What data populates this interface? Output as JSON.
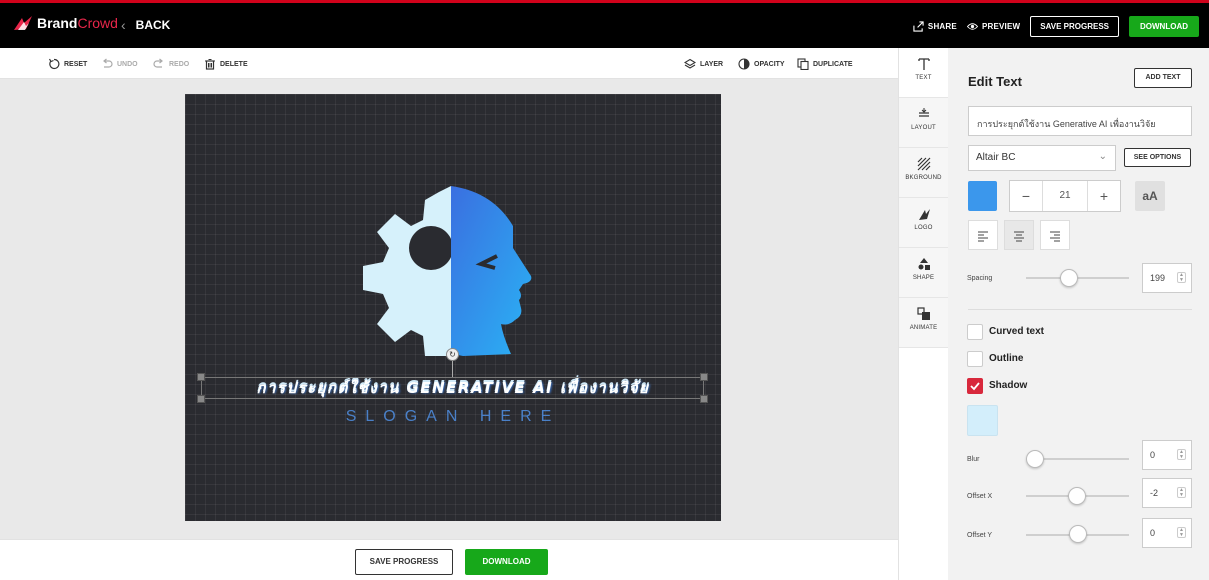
{
  "header": {
    "brand_part1": "Brand",
    "brand_part2": "Crowd",
    "back_label": "BACK",
    "share_label": "SHARE",
    "preview_label": "PREVIEW",
    "save_progress_label": "SAVE PROGRESS",
    "download_label": "DOWNLOAD"
  },
  "toolbar": {
    "reset": "RESET",
    "undo": "UNDO",
    "redo": "REDO",
    "delete": "DELETE",
    "layer": "LAYER",
    "opacity": "OPACITY",
    "duplicate": "DUPLICATE"
  },
  "canvas": {
    "main_text": "การประยุกต์ใช้งาน GENERATIVE AI เพื่องานวิจัย",
    "slogan": "SLOGAN HERE"
  },
  "bottom": {
    "save_progress": "SAVE PROGRESS",
    "download": "DOWNLOAD"
  },
  "side_tabs": [
    {
      "label": "TEXT",
      "icon": "text-icon"
    },
    {
      "label": "LAYOUT",
      "icon": "layout-icon"
    },
    {
      "label": "BKGROUND",
      "icon": "background-icon"
    },
    {
      "label": "LOGO",
      "icon": "logo-icon"
    },
    {
      "label": "SHAPE",
      "icon": "shape-icon"
    },
    {
      "label": "ANIMATE",
      "icon": "animate-icon"
    }
  ],
  "panel": {
    "title": "Edit Text",
    "add_text": "ADD TEXT",
    "text_value": "การประยุกต์ใช้งาน Generative AI เพื่องานวิจัย",
    "font": "Altair BC",
    "see_options": "SEE OPTIONS",
    "text_color": "#3b97ec",
    "font_size": "21",
    "case_toggle": "aA",
    "spacing_label": "Spacing",
    "spacing_value": "199",
    "curved_text": "Curved text",
    "outline": "Outline",
    "shadow": "Shadow",
    "shadow_checked": true,
    "shadow_color": "#d3eefb",
    "blur_label": "Blur",
    "blur_value": "0",
    "offset_x_label": "Offset X",
    "offset_x_value": "-2",
    "offset_y_label": "Offset Y",
    "offset_y_value": "0"
  },
  "colors": {
    "accent_red": "#d0021b",
    "download_green": "#17a81a",
    "artboard_bg": "#2a2b30"
  }
}
